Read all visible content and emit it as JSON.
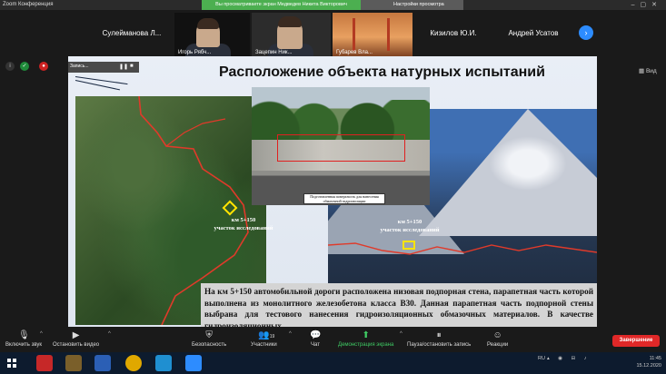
{
  "window": {
    "app_title": "Zoom Конференция",
    "share_banner": "Вы просматриваете экран Медведев Никита Викторович",
    "view_options": "Настройки просмотра"
  },
  "participants": [
    {
      "name": "Сулейманова  Л...",
      "type": "name"
    },
    {
      "name": "Игорь Рябч...",
      "type": "video"
    },
    {
      "name": "Зацепин Ник...",
      "type": "video"
    },
    {
      "name": "Губарев Вла...",
      "type": "image"
    },
    {
      "name": "Кизилов Ю.И.",
      "type": "name"
    },
    {
      "name": "Андрей Усатов",
      "type": "name"
    }
  ],
  "view_button": "Вид",
  "slide": {
    "title": "Расположение объекта натурных испытаний",
    "annot_label": "Запись...",
    "km_label_left_1": "км 5+150",
    "km_label_left_2": "участок исследований",
    "km_label_right_1": "км 5+150",
    "km_label_right_2": "участок исследований",
    "photo_caption": "Подготовленная поверхность для нанесения обмазочной гидроизоляции",
    "body_text": "На км 5+150 автомобильной дороги расположена низовая подпорная стена, парапетная часть которой выполнена из монолитного железобетона класса В30. Данная парапетная часть подпорной стены выбрана для тестового нанесения гидроизоляционных обмазочных материалов. В качестве гидроизоляционных"
  },
  "toolbar": {
    "audio": "Включить звук",
    "video": "Остановить видео",
    "security": "Безопасность",
    "participants": "Участники",
    "participants_count": "19",
    "chat": "Чат",
    "share": "Демонстрация экрана",
    "record": "Пауза/остановить запись",
    "reactions": "Реакции",
    "end": "Завершение"
  },
  "taskbar": {
    "lang": "RU",
    "time": "11:45",
    "date": "15.12.2020"
  },
  "colors": {
    "zoom_green": "#4caf50",
    "zoom_blue": "#2d8cff",
    "end_red": "#e02828",
    "route_red": "#e03a2a",
    "marker_yellow": "#ffe400"
  }
}
